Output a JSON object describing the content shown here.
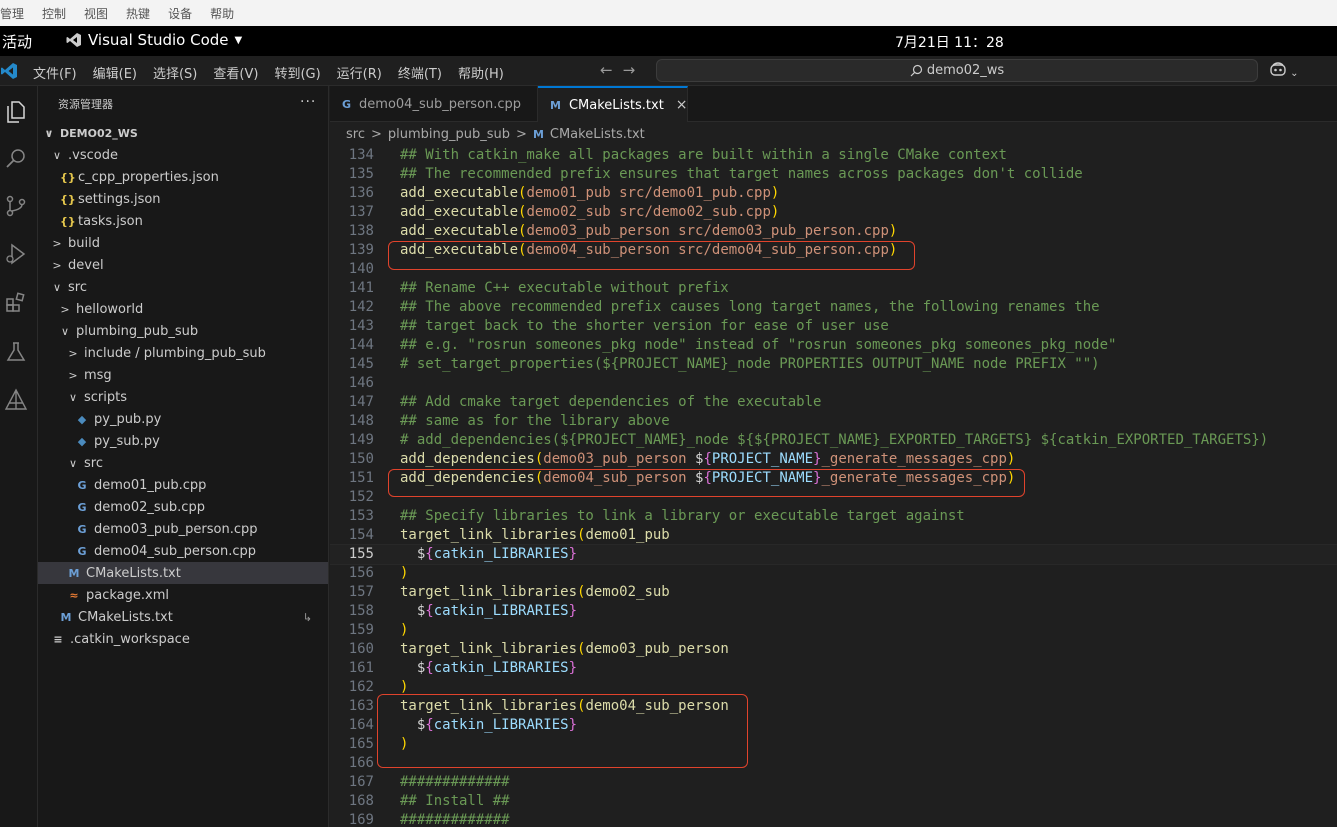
{
  "host_menu": [
    "管理",
    "控制",
    "视图",
    "热键",
    "设备",
    "帮助"
  ],
  "gnome": {
    "activities": "活动",
    "app_name": "Visual Studio Code",
    "clock": "7月21日  11：28"
  },
  "menu": [
    "文件(F)",
    "编辑(E)",
    "选择(S)",
    "查看(V)",
    "转到(G)",
    "运行(R)",
    "终端(T)",
    "帮助(H)"
  ],
  "search": {
    "value": "demo02_ws"
  },
  "sidebar": {
    "title": "资源管理器",
    "more": "···",
    "tree": [
      {
        "label": "DEMO02_WS",
        "chev": "∨",
        "icon": "",
        "indent": 0,
        "bold": true
      },
      {
        "label": ".vscode",
        "chev": "∨",
        "icon": "",
        "indent": 1
      },
      {
        "label": "c_cpp_properties.json",
        "chev": "",
        "icon": "{}",
        "type": "json",
        "indent": 2
      },
      {
        "label": "settings.json",
        "chev": "",
        "icon": "{}",
        "type": "json",
        "indent": 2
      },
      {
        "label": "tasks.json",
        "chev": "",
        "icon": "{}",
        "type": "json",
        "indent": 2
      },
      {
        "label": "build",
        "chev": ">",
        "icon": "",
        "indent": 1
      },
      {
        "label": "devel",
        "chev": ">",
        "icon": "",
        "indent": 1
      },
      {
        "label": "src",
        "chev": "∨",
        "icon": "",
        "indent": 1
      },
      {
        "label": "helloworld",
        "chev": ">",
        "icon": "",
        "indent": 2
      },
      {
        "label": "plumbing_pub_sub",
        "chev": "∨",
        "icon": "",
        "indent": 2
      },
      {
        "label": "include / plumbing_pub_sub",
        "chev": ">",
        "icon": "",
        "indent": 3
      },
      {
        "label": "msg",
        "chev": ">",
        "icon": "",
        "indent": 3
      },
      {
        "label": "scripts",
        "chev": "∨",
        "icon": "",
        "indent": 3
      },
      {
        "label": "py_pub.py",
        "chev": "",
        "icon": "◆",
        "type": "py",
        "indent": 4
      },
      {
        "label": "py_sub.py",
        "chev": "",
        "icon": "◆",
        "type": "py",
        "indent": 4
      },
      {
        "label": "src",
        "chev": "∨",
        "icon": "",
        "indent": 3
      },
      {
        "label": "demo01_pub.cpp",
        "chev": "",
        "icon": "G",
        "type": "cpp",
        "indent": 4
      },
      {
        "label": "demo02_sub.cpp",
        "chev": "",
        "icon": "G",
        "type": "cpp",
        "indent": 4
      },
      {
        "label": "demo03_pub_person.cpp",
        "chev": "",
        "icon": "G",
        "type": "cpp",
        "indent": 4
      },
      {
        "label": "demo04_sub_person.cpp",
        "chev": "",
        "icon": "G",
        "type": "cpp",
        "indent": 4
      },
      {
        "label": "CMakeLists.txt",
        "chev": "",
        "icon": "M",
        "type": "cmake",
        "indent": 3,
        "selected": true
      },
      {
        "label": "package.xml",
        "chev": "",
        "icon": "≈",
        "type": "xml",
        "indent": 3
      },
      {
        "label": "CMakeLists.txt",
        "chev": "",
        "icon": "M",
        "type": "cmake",
        "indent": 2,
        "aside": "↳"
      },
      {
        "label": ".catkin_workspace",
        "chev": "",
        "icon": "≡",
        "type": "txt",
        "indent": 1
      }
    ]
  },
  "tabs": [
    {
      "label": "demo04_sub_person.cpp",
      "icon": "G",
      "active": false
    },
    {
      "label": "CMakeLists.txt",
      "icon": "M",
      "active": true,
      "close": "×"
    }
  ],
  "breadcrumb": {
    "parts": [
      "src",
      "plumbing_pub_sub",
      "CMakeLists.txt"
    ],
    "sep": ">"
  },
  "editor": {
    "current_line": 155,
    "lines": [
      {
        "n": 134,
        "t": "comment",
        "text": "## With catkin_make all packages are built within a single CMake context"
      },
      {
        "n": 135,
        "t": "comment",
        "text": "## The recommended prefix ensures that target names across packages don't collide"
      },
      {
        "n": 136,
        "t": "call",
        "fn": "add_executable",
        "args": "demo01_pub src/demo01_pub.cpp"
      },
      {
        "n": 137,
        "t": "call",
        "fn": "add_executable",
        "args": "demo02_sub src/demo02_sub.cpp"
      },
      {
        "n": 138,
        "t": "call",
        "fn": "add_executable",
        "args": "demo03_pub_person src/demo03_pub_person.cpp"
      },
      {
        "n": 139,
        "t": "call",
        "fn": "add_executable",
        "args": "demo04_sub_person src/demo04_sub_person.cpp"
      },
      {
        "n": 140,
        "t": "blank",
        "text": ""
      },
      {
        "n": 141,
        "t": "comment",
        "text": "## Rename C++ executable without prefix"
      },
      {
        "n": 142,
        "t": "comment",
        "text": "## The above recommended prefix causes long target names, the following renames the"
      },
      {
        "n": 143,
        "t": "comment",
        "text": "## target back to the shorter version for ease of user use"
      },
      {
        "n": 144,
        "t": "comment",
        "text": "## e.g. \"rosrun someones_pkg node\" instead of \"rosrun someones_pkg someones_pkg_node\""
      },
      {
        "n": 145,
        "t": "comment",
        "text": "# set_target_properties(${PROJECT_NAME}_node PROPERTIES OUTPUT_NAME node PREFIX \"\")"
      },
      {
        "n": 146,
        "t": "blank",
        "text": ""
      },
      {
        "n": 147,
        "t": "comment",
        "text": "## Add cmake target dependencies of the executable"
      },
      {
        "n": 148,
        "t": "comment",
        "text": "## same as for the library above"
      },
      {
        "n": 149,
        "t": "comment",
        "text": "# add_dependencies(${PROJECT_NAME}_node ${${PROJECT_NAME}_EXPORTED_TARGETS} ${catkin_EXPORTED_TARGETS})"
      },
      {
        "n": 150,
        "t": "dep",
        "fn": "add_dependencies",
        "a1": "demo03_pub_person ",
        "var": "PROJECT_NAME",
        "a2": "_generate_messages_cpp"
      },
      {
        "n": 151,
        "t": "dep",
        "fn": "add_dependencies",
        "a1": "demo04_sub_person ",
        "var": "PROJECT_NAME",
        "a2": "_generate_messages_cpp"
      },
      {
        "n": 152,
        "t": "blank",
        "text": ""
      },
      {
        "n": 153,
        "t": "comment",
        "text": "## Specify libraries to link a library or executable target against"
      },
      {
        "n": 154,
        "t": "open",
        "fn": "target_link_libraries",
        "args": "demo01_pub"
      },
      {
        "n": 155,
        "t": "var",
        "var": "catkin_LIBRARIES"
      },
      {
        "n": 156,
        "t": "close",
        "text": ")"
      },
      {
        "n": 157,
        "t": "open",
        "fn": "target_link_libraries",
        "args": "demo02_sub"
      },
      {
        "n": 158,
        "t": "var",
        "var": "catkin_LIBRARIES"
      },
      {
        "n": 159,
        "t": "close",
        "text": ")"
      },
      {
        "n": 160,
        "t": "open",
        "fn": "target_link_libraries",
        "args": "demo03_pub_person"
      },
      {
        "n": 161,
        "t": "var",
        "var": "catkin_LIBRARIES"
      },
      {
        "n": 162,
        "t": "close",
        "text": ")"
      },
      {
        "n": 163,
        "t": "open",
        "fn": "target_link_libraries",
        "args": "demo04_sub_person"
      },
      {
        "n": 164,
        "t": "var",
        "var": "catkin_LIBRARIES"
      },
      {
        "n": 165,
        "t": "close",
        "text": ")"
      },
      {
        "n": 166,
        "t": "blank",
        "text": ""
      },
      {
        "n": 167,
        "t": "comment",
        "text": "#############"
      },
      {
        "n": 168,
        "t": "comment",
        "text": "## Install ##"
      },
      {
        "n": 169,
        "t": "comment",
        "text": "#############"
      }
    ]
  },
  "annotation_color": "#e0432c"
}
